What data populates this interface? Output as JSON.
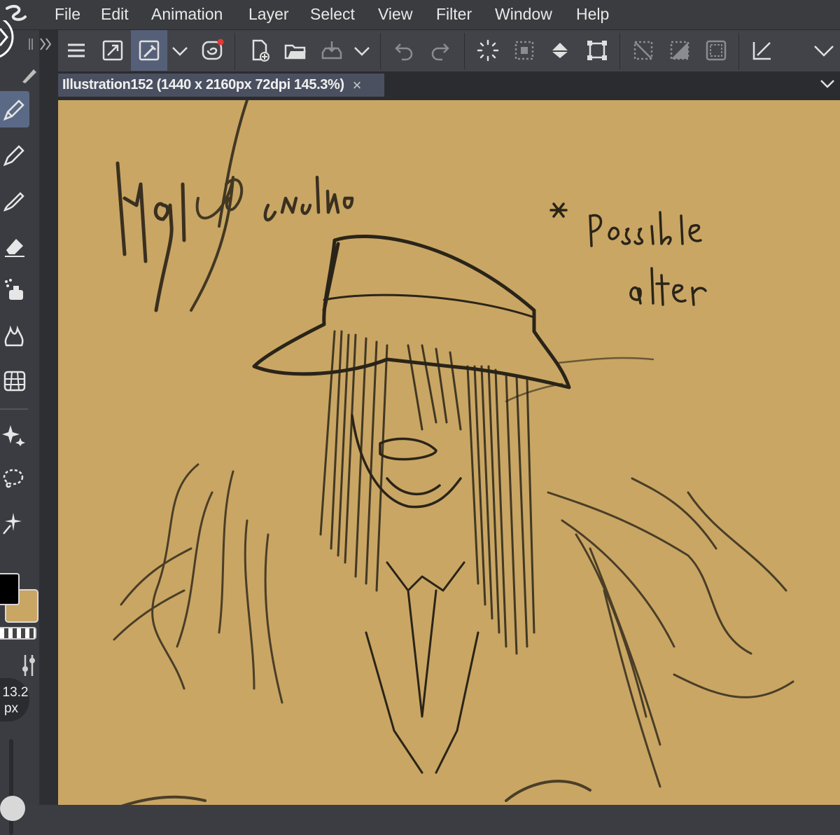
{
  "menu": [
    "File",
    "Edit",
    "Animation",
    "Layer",
    "Select",
    "View",
    "Filter",
    "Window",
    "Help"
  ],
  "toolbar": {
    "buttons": [
      {
        "name": "hamburger-menu-icon"
      },
      {
        "name": "resize-icon"
      },
      {
        "name": "eyedropper-icon",
        "active": true
      },
      {
        "name": "chevron-down-icon"
      },
      {
        "name": "spiral-record-icon",
        "badge_color": "#e53935"
      },
      {
        "name": "new-file-icon"
      },
      {
        "name": "open-folder-icon"
      },
      {
        "name": "save-tray-icon"
      },
      {
        "name": "chevron-down-icon"
      },
      {
        "name": "undo-icon"
      },
      {
        "name": "redo-icon"
      },
      {
        "name": "loading-spinner-icon"
      },
      {
        "name": "selection-dots-icon"
      },
      {
        "name": "fill-bucket-icon"
      },
      {
        "name": "transform-icon"
      },
      {
        "name": "deselect-icon"
      },
      {
        "name": "invert-selection-icon"
      },
      {
        "name": "selection-frame-icon"
      },
      {
        "name": "arrow-corner-icon"
      },
      {
        "name": "chevron-down-icon"
      }
    ]
  },
  "document_tab": {
    "title": "Illustration152 (1440 x 2160px 72dpi 145.3%)",
    "close": "×"
  },
  "tools": [
    {
      "name": "pen-tool-icon",
      "active": true
    },
    {
      "name": "pencil-tool-icon"
    },
    {
      "name": "brush-tool-icon"
    },
    {
      "name": "eraser-tool-icon"
    },
    {
      "name": "airbrush-tool-icon"
    },
    {
      "name": "blend-tool-icon"
    },
    {
      "name": "perspective-grid-icon"
    },
    {
      "name": "sparkle-tool-icon"
    },
    {
      "name": "lasso-tool-icon"
    },
    {
      "name": "magic-wand-icon"
    }
  ],
  "colors": {
    "main": "#000000",
    "sub": "#c9a664",
    "canvas": "#c9a664",
    "ink": "#2a2418"
  },
  "brush_size": {
    "value": "13.2",
    "unit": "px"
  },
  "canvas_notes": {
    "note": "* Possible alter"
  }
}
